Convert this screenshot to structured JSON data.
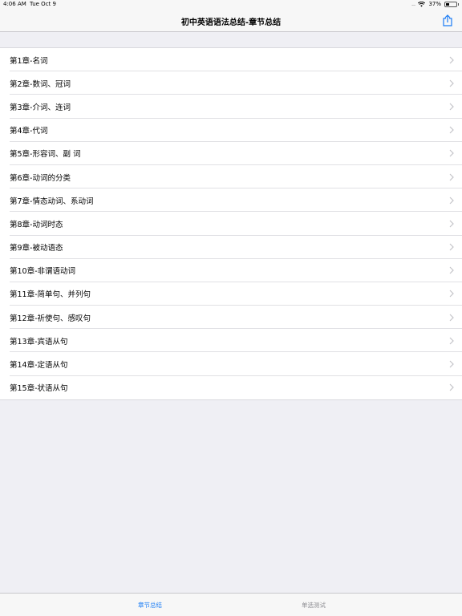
{
  "status_bar": {
    "time": "4:06 AM",
    "date": "Tue Oct 9",
    "signal": ".....",
    "battery_percent": "37%",
    "battery_level": 0.37
  },
  "nav": {
    "title": "初中英语语法总结-章节总结",
    "share_icon": "share-icon"
  },
  "chapters": [
    "第1章-名词",
    "第2章-数词、冠词",
    "第3章-介词、连词",
    "第4章-代词",
    "第5章-形容词、副 词",
    "第6章-动词的分类",
    "第7章-情态动词、系动词",
    "第8章-动词时态",
    "第9章-被动语态",
    "第10章-非谓语动词",
    "第11章-简单句、并列句",
    "第12章-祈使句、感叹句",
    "第13章-宾语从句",
    "第14章-定语从句",
    "第15章-状语从句"
  ],
  "tabs": {
    "active": "章节总结",
    "inactive": "单选测试"
  },
  "colors": {
    "accent": "#1b7cf5",
    "inactive": "#8e8e93",
    "background": "#efeff4"
  }
}
